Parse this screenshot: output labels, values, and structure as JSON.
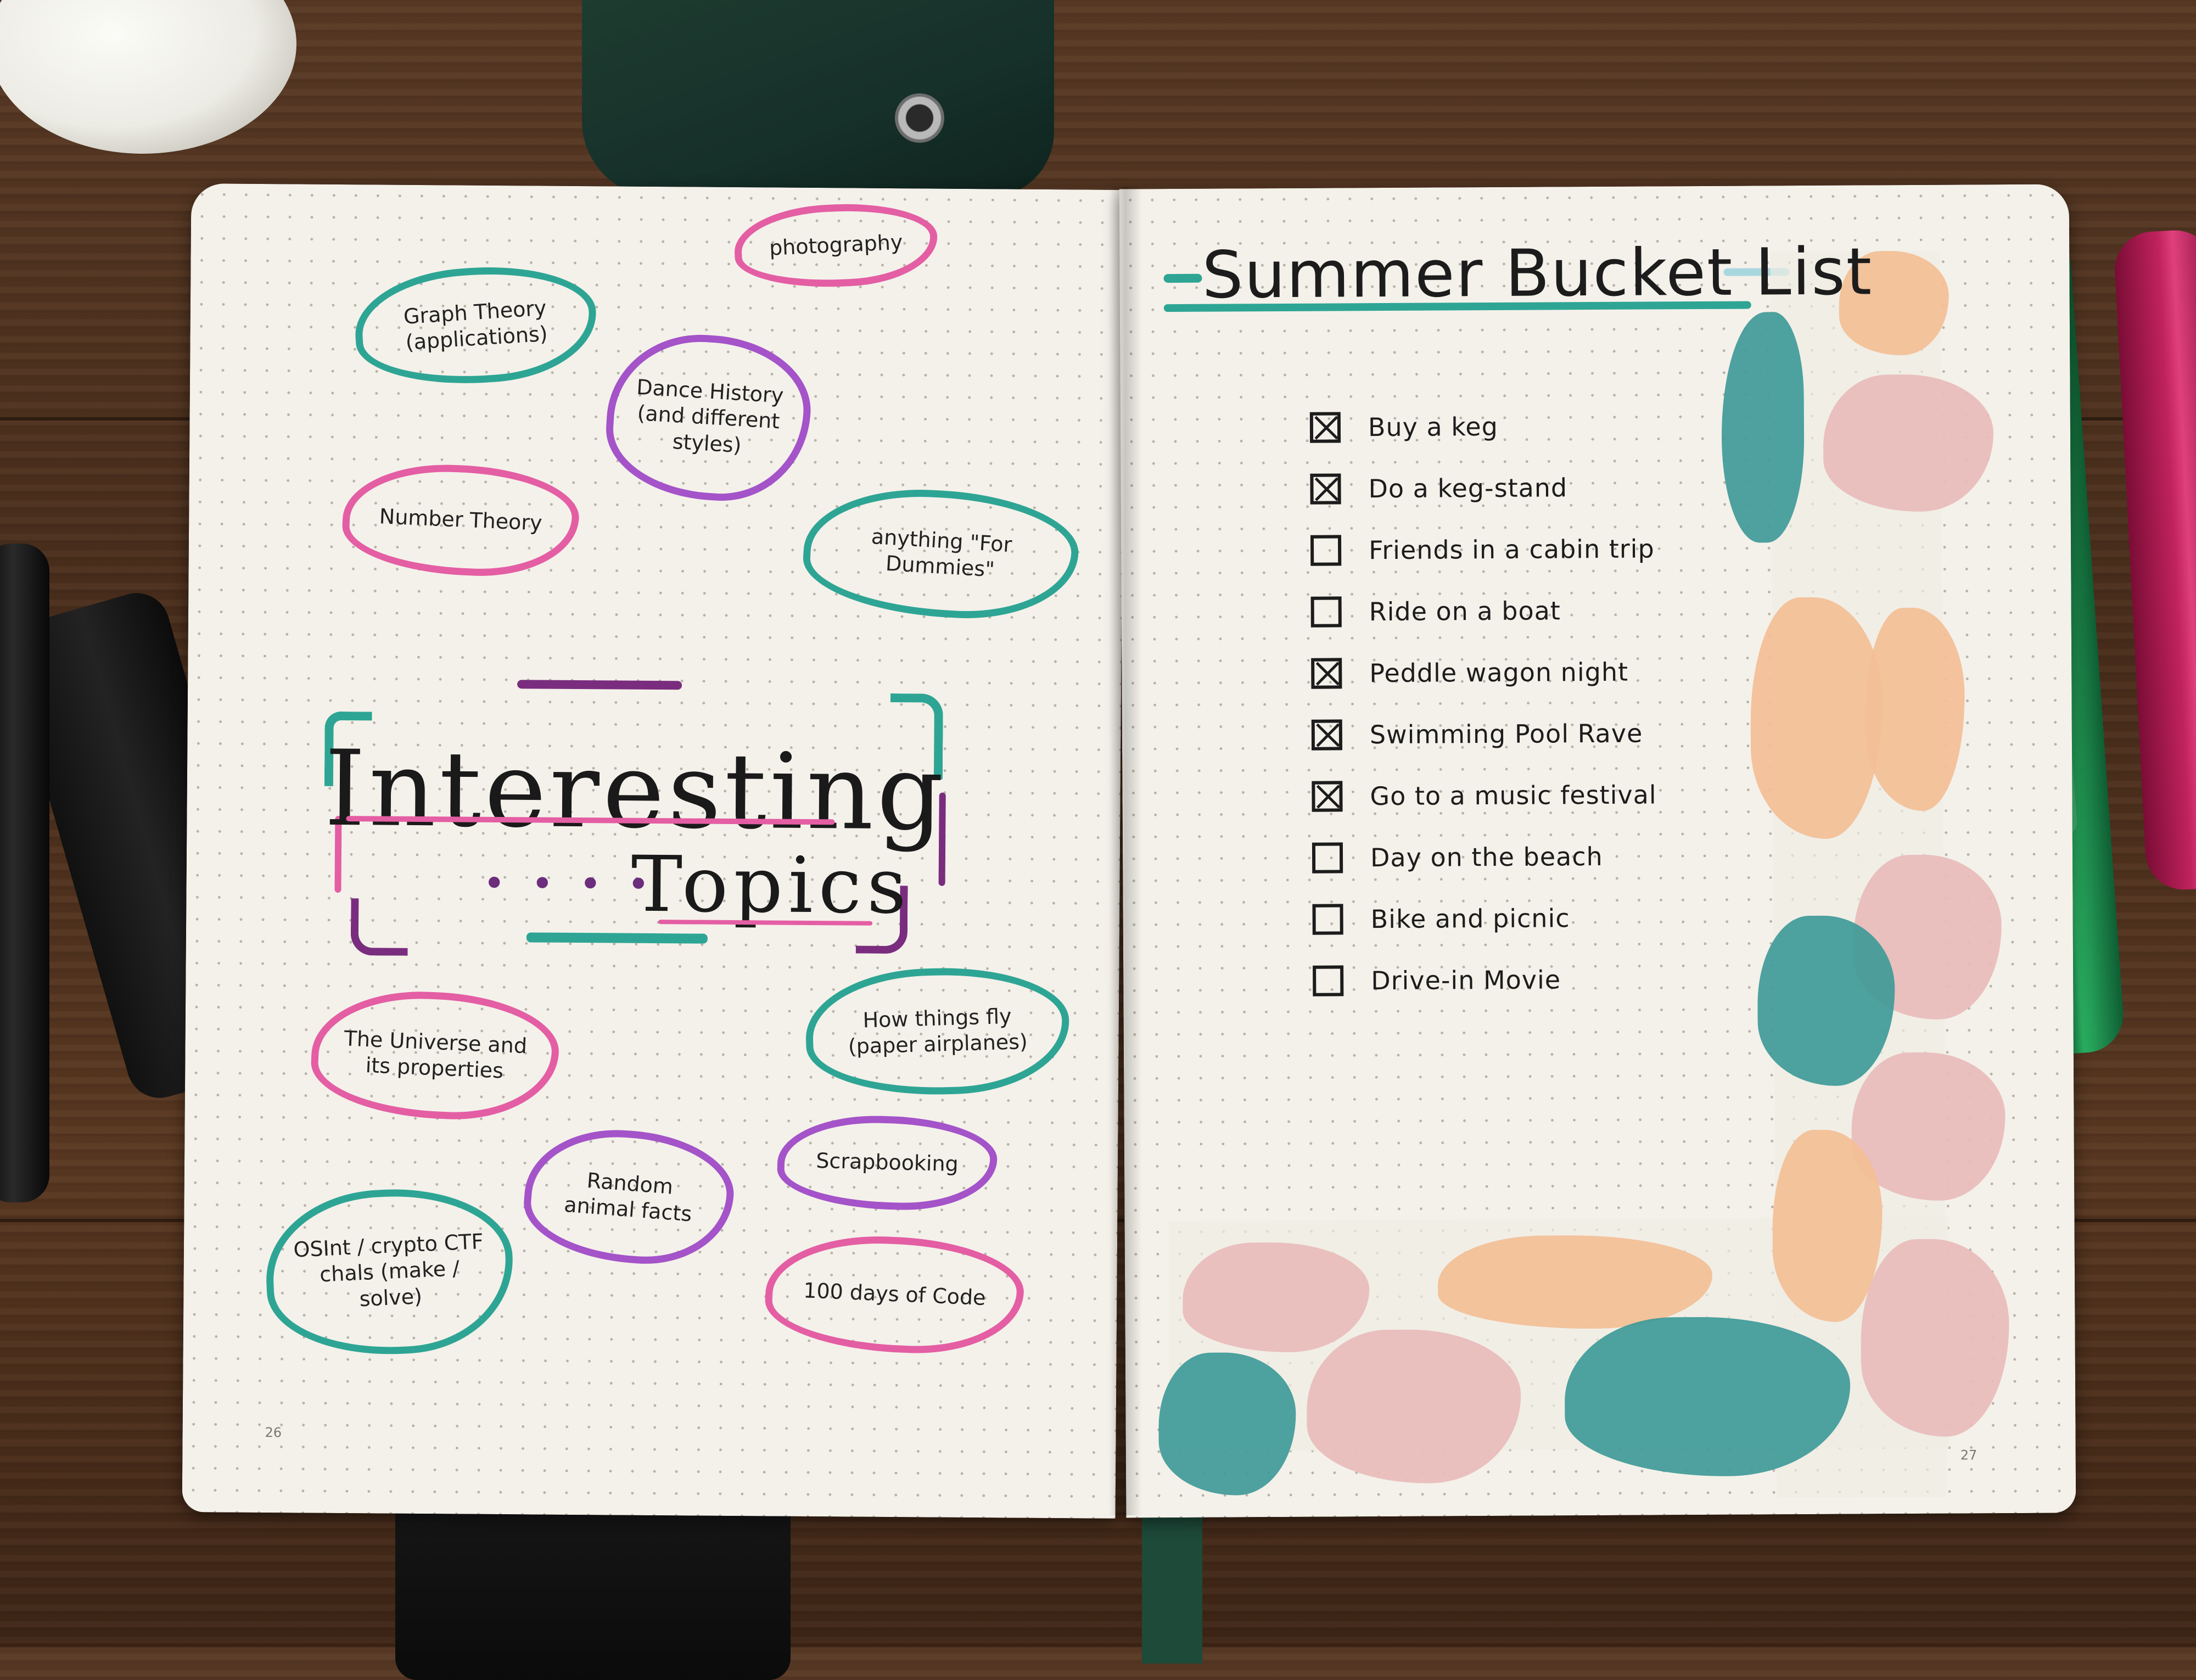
{
  "left_page": {
    "page_number": "26",
    "title_line1": "Interesting",
    "title_line2": "Topics",
    "title_dots": "• • • •",
    "topics": [
      {
        "label": "Graph Theory (applications)",
        "color": "teal"
      },
      {
        "label": "photography",
        "color": "pink"
      },
      {
        "label": "Dance History (and different styles)",
        "color": "purple"
      },
      {
        "label": "Number Theory",
        "color": "pink"
      },
      {
        "label": "anything \"For Dummies\"",
        "color": "teal"
      },
      {
        "label": "The Universe and its properties",
        "color": "pink"
      },
      {
        "label": "How things fly (paper airplanes)",
        "color": "teal"
      },
      {
        "label": "Random animal facts",
        "color": "purple"
      },
      {
        "label": "Scrapbooking",
        "color": "purple"
      },
      {
        "label": "OSInt / crypto CTF chals (make / solve)",
        "color": "teal"
      },
      {
        "label": "100 days of Code",
        "color": "pink"
      }
    ]
  },
  "right_page": {
    "page_number": "27",
    "title": "Summer Bucket List",
    "tasks": [
      {
        "label": "Buy a keg",
        "checked": true
      },
      {
        "label": "Do a keg-stand",
        "checked": true
      },
      {
        "label": "Friends in a cabin trip",
        "checked": false
      },
      {
        "label": "Ride on a boat",
        "checked": false
      },
      {
        "label": "Peddle wagon night",
        "checked": true
      },
      {
        "label": "Swimming Pool Rave",
        "checked": true
      },
      {
        "label": "Go to a music festival",
        "checked": true
      },
      {
        "label": "Day on the beach",
        "checked": false
      },
      {
        "label": "Bike and picnic",
        "checked": false
      },
      {
        "label": "Drive-in Movie",
        "checked": false
      }
    ]
  },
  "colors": {
    "teal": "#2ea594",
    "pink": "#e45ea4",
    "purple": "#a453c9",
    "tape_peach": "#f3bf96",
    "tape_pink": "#e8bcbb",
    "tape_teal": "#3f9a98"
  }
}
